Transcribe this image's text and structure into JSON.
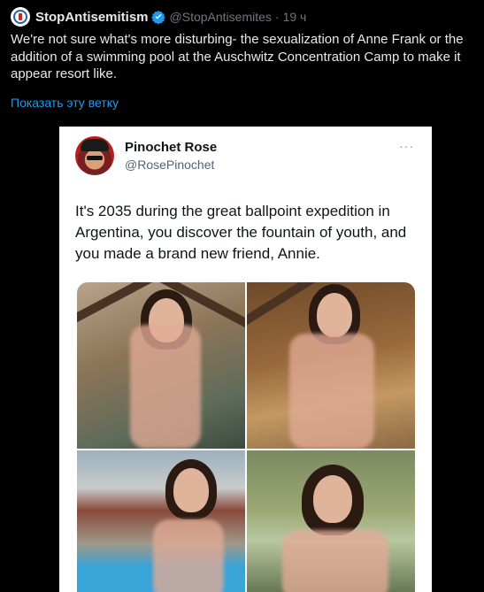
{
  "tweet": {
    "display_name": "StopAntisemitism",
    "handle": "@StopAntisemites",
    "separator": "·",
    "time": "19 ч",
    "text": "We're not sure what's more disturbing- the sexualization of Anne Frank or the addition of a swimming pool at the Auschwitz Concentration Camp to make it appear resort like.",
    "show_thread": "Показать эту ветку"
  },
  "embedded": {
    "display_name": "Pinochet Rose",
    "handle": "@RosePinochet",
    "more": "···",
    "text": "It's 2035 during the great ballpoint expedition in Argentina, you discover the fountain of youth, and  you made a brand new friend, Annie."
  },
  "colors": {
    "background": "#000000",
    "text": "#e7e9ea",
    "muted": "#71767b",
    "link": "#1d9bf0",
    "verified": "#1d9bf0"
  }
}
